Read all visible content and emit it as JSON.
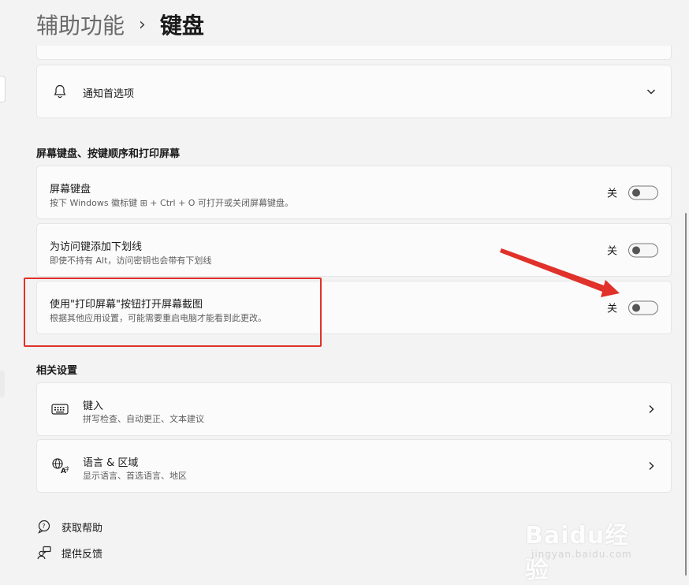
{
  "breadcrumb": {
    "parent": "辅助功能",
    "separator": "›",
    "current": "键盘"
  },
  "notifications": {
    "label": "通知首选项"
  },
  "section_keyboard": {
    "title": "屏幕键盘、按键顺序和打印屏幕",
    "items": [
      {
        "title": "屏幕键盘",
        "subtitle": "按下 Windows 徽标键 ⊞ + Ctrl + O 可打开或关闭屏幕键盘。",
        "state": "关"
      },
      {
        "title": "为访问键添加下划线",
        "subtitle": "即使不持有 Alt，访问密钥也会带有下划线",
        "state": "关"
      },
      {
        "title": "使用\"打印屏幕\"按钮打开屏幕截图",
        "subtitle": "根据其他应用设置，可能需要重启电脑才能看到此更改。",
        "state": "关"
      }
    ]
  },
  "section_related": {
    "title": "相关设置",
    "items": [
      {
        "title": "键入",
        "subtitle": "拼写检查、自动更正、文本建议",
        "icon": "keyboard-icon"
      },
      {
        "title": "语言 & 区域",
        "subtitle": "显示语言、首选语言、地区",
        "icon": "language-icon"
      }
    ]
  },
  "footer": {
    "help": "获取帮助",
    "feedback": "提供反馈"
  },
  "watermark": {
    "main": "Baidu经验",
    "sub": "jingyan.baidu.com"
  },
  "colors": {
    "highlight": "#e0312a",
    "arrow": "#e0312a"
  }
}
